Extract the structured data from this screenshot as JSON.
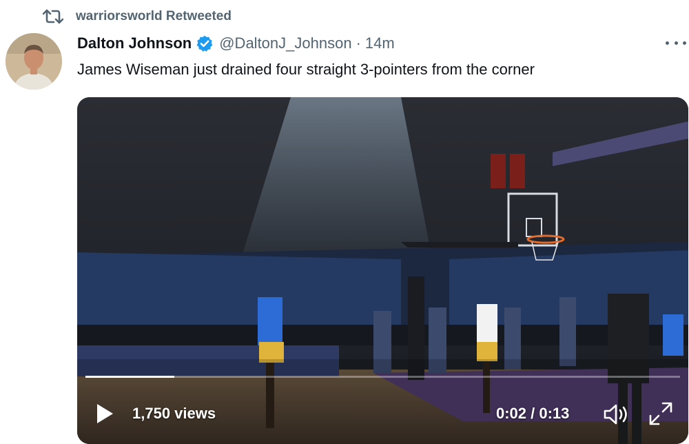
{
  "retweet": {
    "label": "warriorsworld Retweeted",
    "icon": "retweet-icon"
  },
  "tweet": {
    "author_name": "Dalton Johnson",
    "verified": true,
    "verified_icon": "verified-badge-icon",
    "handle": "@DaltonJ_Johnson",
    "separator": "·",
    "time": "14m",
    "text": "James Wiseman just drained four straight 3-pointers from the corner",
    "more_icon": "more-options-icon"
  },
  "video": {
    "views": "1,750 views",
    "timecode": "0:02 / 0:13",
    "progress": 0.15,
    "play_icon": "play-icon",
    "volume_icon": "volume-icon",
    "fullscreen_icon": "fullscreen-icon"
  },
  "colors": {
    "text_primary": "#0f1419",
    "text_secondary": "#536471",
    "verified_blue": "#1d9bf0"
  }
}
